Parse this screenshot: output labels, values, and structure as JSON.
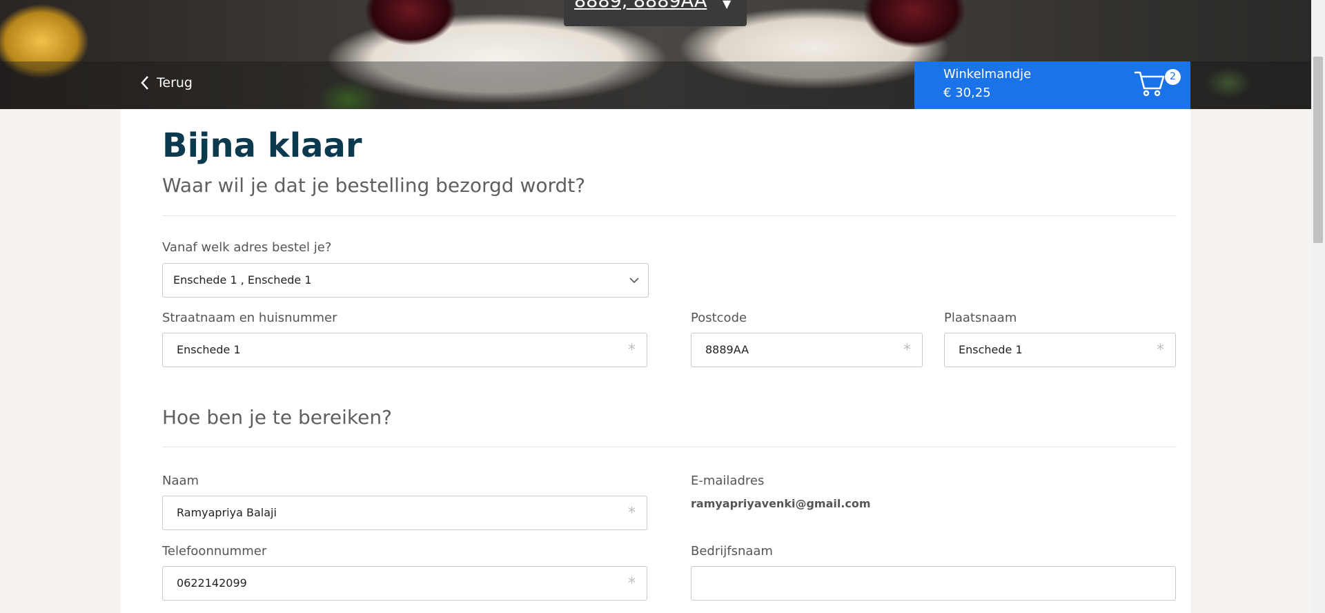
{
  "header": {
    "postcode_display": "8889, 8889AA",
    "back_label": "Terug",
    "cart": {
      "title": "Winkelmandje",
      "amount": "€ 30,25",
      "count": "2"
    }
  },
  "delivery": {
    "heading": "Bijna klaar",
    "subheading": "Waar wil je dat je bestelling bezorgd wordt?",
    "address_select": {
      "label": "Vanaf welk adres bestel je?",
      "value": "Enschede 1 , Enschede 1"
    },
    "street": {
      "label": "Straatnaam en huisnummer",
      "value": "Enschede 1"
    },
    "postcode": {
      "label": "Postcode",
      "value": "8889AA"
    },
    "city": {
      "label": "Plaatsnaam",
      "value": "Enschede 1"
    }
  },
  "contact": {
    "heading": "Hoe ben je te bereiken?",
    "name": {
      "label": "Naam",
      "value": "Ramyapriya Balaji"
    },
    "email": {
      "label": "E-mailadres",
      "value": "ramyapriyavenki@gmail.com"
    },
    "phone": {
      "label": "Telefoonnummer",
      "value": "0622142099"
    },
    "company": {
      "label": "Bedrijfsnaam",
      "value": ""
    }
  },
  "required_marker": "*",
  "colors": {
    "accent": "#1a73e8",
    "heading": "#0b3a4f",
    "page_background": "#f6f2ef"
  }
}
